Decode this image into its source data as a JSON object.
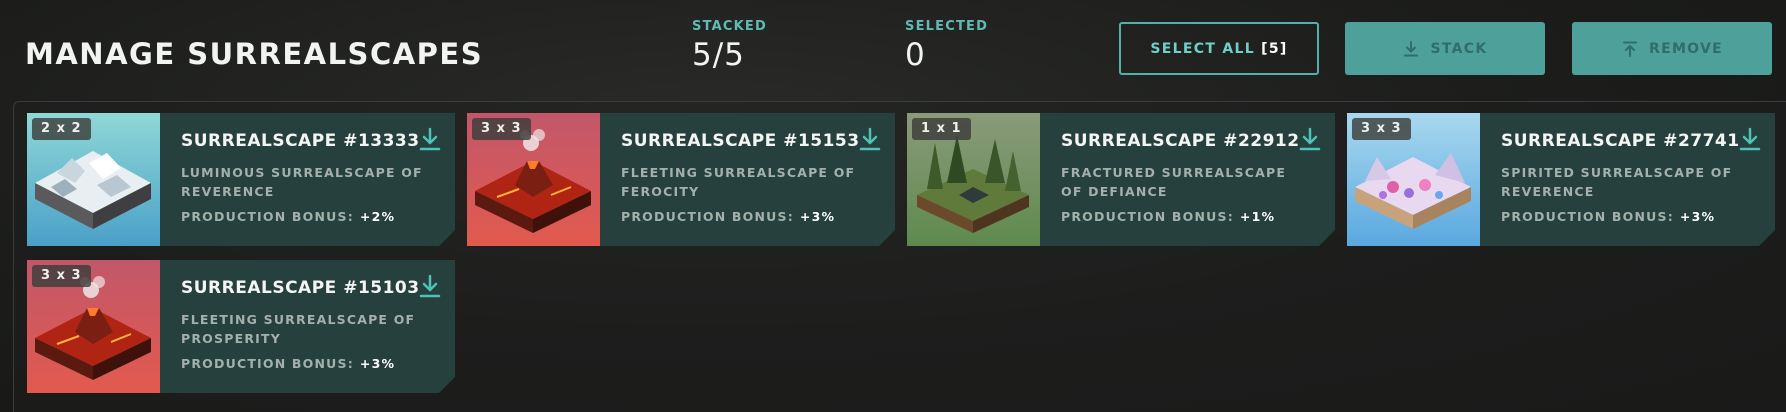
{
  "header": {
    "title": "MANAGE SURREALSCAPES",
    "stacked_label": "STACKED",
    "stacked_value": "5/5",
    "selected_label": "SELECTED",
    "selected_value": "0"
  },
  "buttons": {
    "select_all_label": "SELECT ALL",
    "select_all_count": "[5]",
    "stack_label": "STACK",
    "remove_label": "REMOVE"
  },
  "bonus_label": "PRODUCTION BONUS:",
  "colors": {
    "accent": "#5fbcb4",
    "card_bg": "#25403d",
    "button_fill": "#4ea19b"
  },
  "cards": [
    {
      "size": "2 x 2",
      "title": "SURREALSCAPE #13333",
      "description": "LUMINOUS SURREALSCAPE OF REVERENCE",
      "bonus": "+2%",
      "theme": "snow"
    },
    {
      "size": "3 x 3",
      "title": "SURREALSCAPE #15153",
      "description": "FLEETING SURREALSCAPE OF FEROCITY",
      "bonus": "+3%",
      "theme": "volcano"
    },
    {
      "size": "1 x 1",
      "title": "SURREALSCAPE #22912",
      "description": "FRACTURED SURREALSCAPE OF DEFIANCE",
      "bonus": "+1%",
      "theme": "forest"
    },
    {
      "size": "3 x 3",
      "title": "SURREALSCAPE #27741",
      "description": "SPIRITED SURREALSCAPE OF REVERENCE",
      "bonus": "+3%",
      "theme": "candy"
    },
    {
      "size": "3 x 3",
      "title": "SURREALSCAPE #15103",
      "description": "FLEETING SURREALSCAPE OF PROSPERITY",
      "bonus": "+3%",
      "theme": "volcano"
    }
  ],
  "icons": {
    "card_action": "download-icon",
    "stack": "download-icon",
    "remove": "upload-icon"
  }
}
